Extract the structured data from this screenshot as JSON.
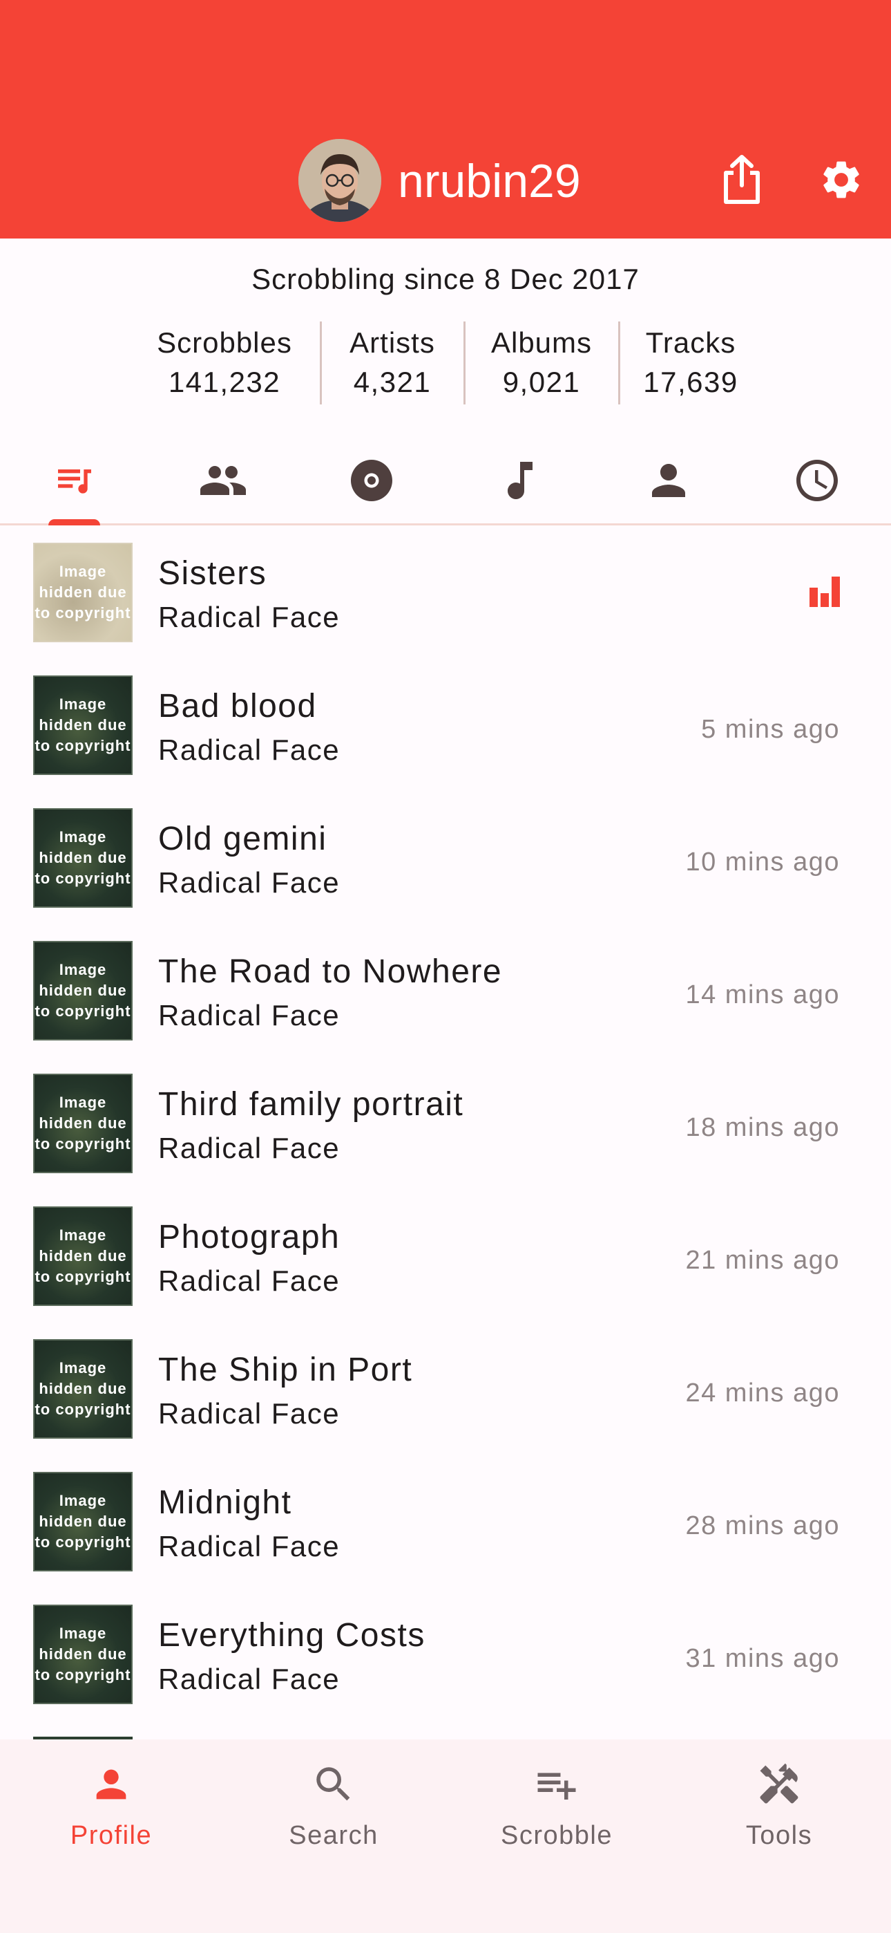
{
  "colors": {
    "accent": "#f44336",
    "icon_dark": "#4f3f3e",
    "muted_text": "#8f8586"
  },
  "header": {
    "username": "nrubin29",
    "share_icon": "share-icon",
    "settings_icon": "gear-icon"
  },
  "profile": {
    "since": "Scrobbling since 8 Dec 2017",
    "stats": [
      {
        "label": "Scrobbles",
        "value": "141,232"
      },
      {
        "label": "Artists",
        "value": "4,321"
      },
      {
        "label": "Albums",
        "value": "9,021"
      },
      {
        "label": "Tracks",
        "value": "17,639"
      }
    ]
  },
  "tabs": [
    {
      "icon": "playlist-icon",
      "selected": true
    },
    {
      "icon": "people-icon",
      "selected": false
    },
    {
      "icon": "album-disc-icon",
      "selected": false
    },
    {
      "icon": "music-note-icon",
      "selected": false
    },
    {
      "icon": "person-icon",
      "selected": false
    },
    {
      "icon": "clock-icon",
      "selected": false
    }
  ],
  "thumbnail_text": "Image hidden due to copyright",
  "scrobbles": [
    {
      "track": "Sisters",
      "artist": "Radical Face",
      "time": "",
      "now_playing": true
    },
    {
      "track": "Bad blood",
      "artist": "Radical Face",
      "time": "5 mins ago"
    },
    {
      "track": "Old gemini",
      "artist": "Radical Face",
      "time": "10 mins ago"
    },
    {
      "track": "The Road to Nowhere",
      "artist": "Radical Face",
      "time": "14 mins ago"
    },
    {
      "track": "Third family portrait",
      "artist": "Radical Face",
      "time": "18 mins ago"
    },
    {
      "track": "Photograph",
      "artist": "Radical Face",
      "time": "21 mins ago"
    },
    {
      "track": "The Ship in Port",
      "artist": "Radical Face",
      "time": "24 mins ago"
    },
    {
      "track": "Midnight",
      "artist": "Radical Face",
      "time": "28 mins ago"
    },
    {
      "track": "Everything Costs",
      "artist": "Radical Face",
      "time": "31 mins ago"
    }
  ],
  "bottom_nav": [
    {
      "label": "Profile",
      "icon": "person-icon",
      "active": true
    },
    {
      "label": "Search",
      "icon": "search-icon",
      "active": false
    },
    {
      "label": "Scrobble",
      "icon": "playlist-add-icon",
      "active": false
    },
    {
      "label": "Tools",
      "icon": "tools-icon",
      "active": false
    }
  ]
}
